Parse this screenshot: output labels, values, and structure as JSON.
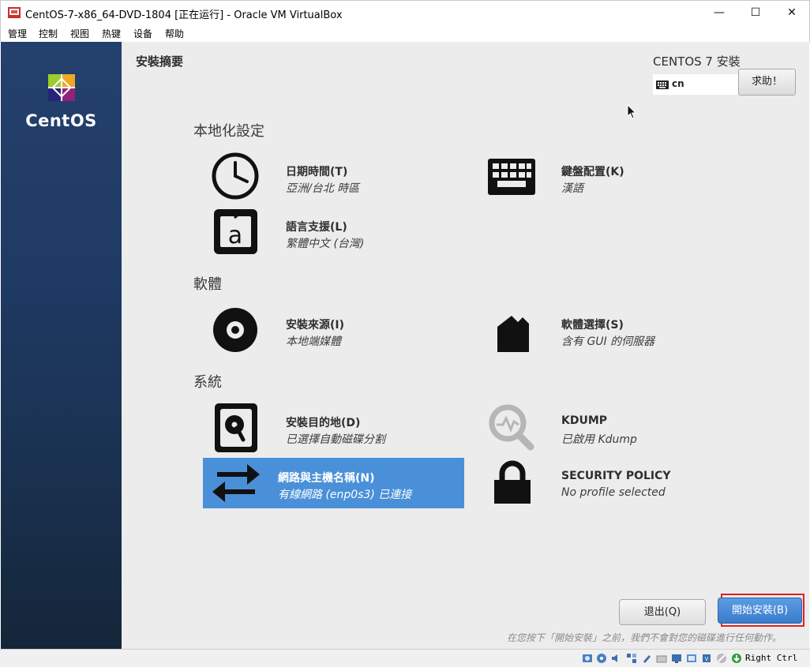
{
  "window": {
    "title": "CentOS-7-x86_64-DVD-1804 [正在运行] - Oracle VM VirtualBox",
    "minimize": "—",
    "maximize": "☐",
    "close": "✕"
  },
  "menu": [
    "管理",
    "控制",
    "视图",
    "热键",
    "设备",
    "帮助"
  ],
  "sidebar": {
    "brand": "CentOS"
  },
  "header": {
    "page_title": "安裝摘要",
    "product_title": "CENTOS 7 安裝",
    "keyboard_layout": "cn",
    "help_label": "求助！"
  },
  "sections": {
    "localization": "本地化設定",
    "software": "軟體",
    "system": "系統"
  },
  "spokes": {
    "datetime": {
      "title": "日期時間(T)",
      "status": "亞洲/台北 時區",
      "icon": "clock-icon"
    },
    "keyboard": {
      "title": "鍵盤配置(K)",
      "status": "漢語",
      "icon": "keyboard-icon"
    },
    "language": {
      "title": "語言支援(L)",
      "status": "繁體中文 (台灣)",
      "icon": "language-icon"
    },
    "source": {
      "title": "安裝來源(I)",
      "status": "本地端媒體",
      "icon": "disc-icon"
    },
    "software": {
      "title": "軟體選擇(S)",
      "status": "含有 GUI 的伺服器",
      "icon": "package-icon"
    },
    "destination": {
      "title": "安裝目的地(D)",
      "status": "已選擇自動磁碟分割",
      "icon": "harddisk-icon"
    },
    "kdump": {
      "title": "KDUMP",
      "status": "已啟用 Kdump",
      "icon": "kdump-search-icon"
    },
    "network": {
      "title": "網路與主機名稱(N)",
      "status": "有線網路 (enp0s3) 已連接",
      "icon": "network-arrows-icon"
    },
    "security": {
      "title": "SECURITY POLICY",
      "status": "No profile selected",
      "icon": "lock-icon"
    }
  },
  "footer": {
    "quit_label": "退出(Q)",
    "begin_label": "開始安裝(B)",
    "disclaimer": "在您按下「開始安裝」之前，我們不會對您的磁碟進行任何動作。"
  },
  "statusbar": {
    "host_key": "Right Ctrl"
  },
  "colors": {
    "accent": "#4a90d9",
    "sidebar": "#1f3a63",
    "highlight_border": "#e02020"
  }
}
